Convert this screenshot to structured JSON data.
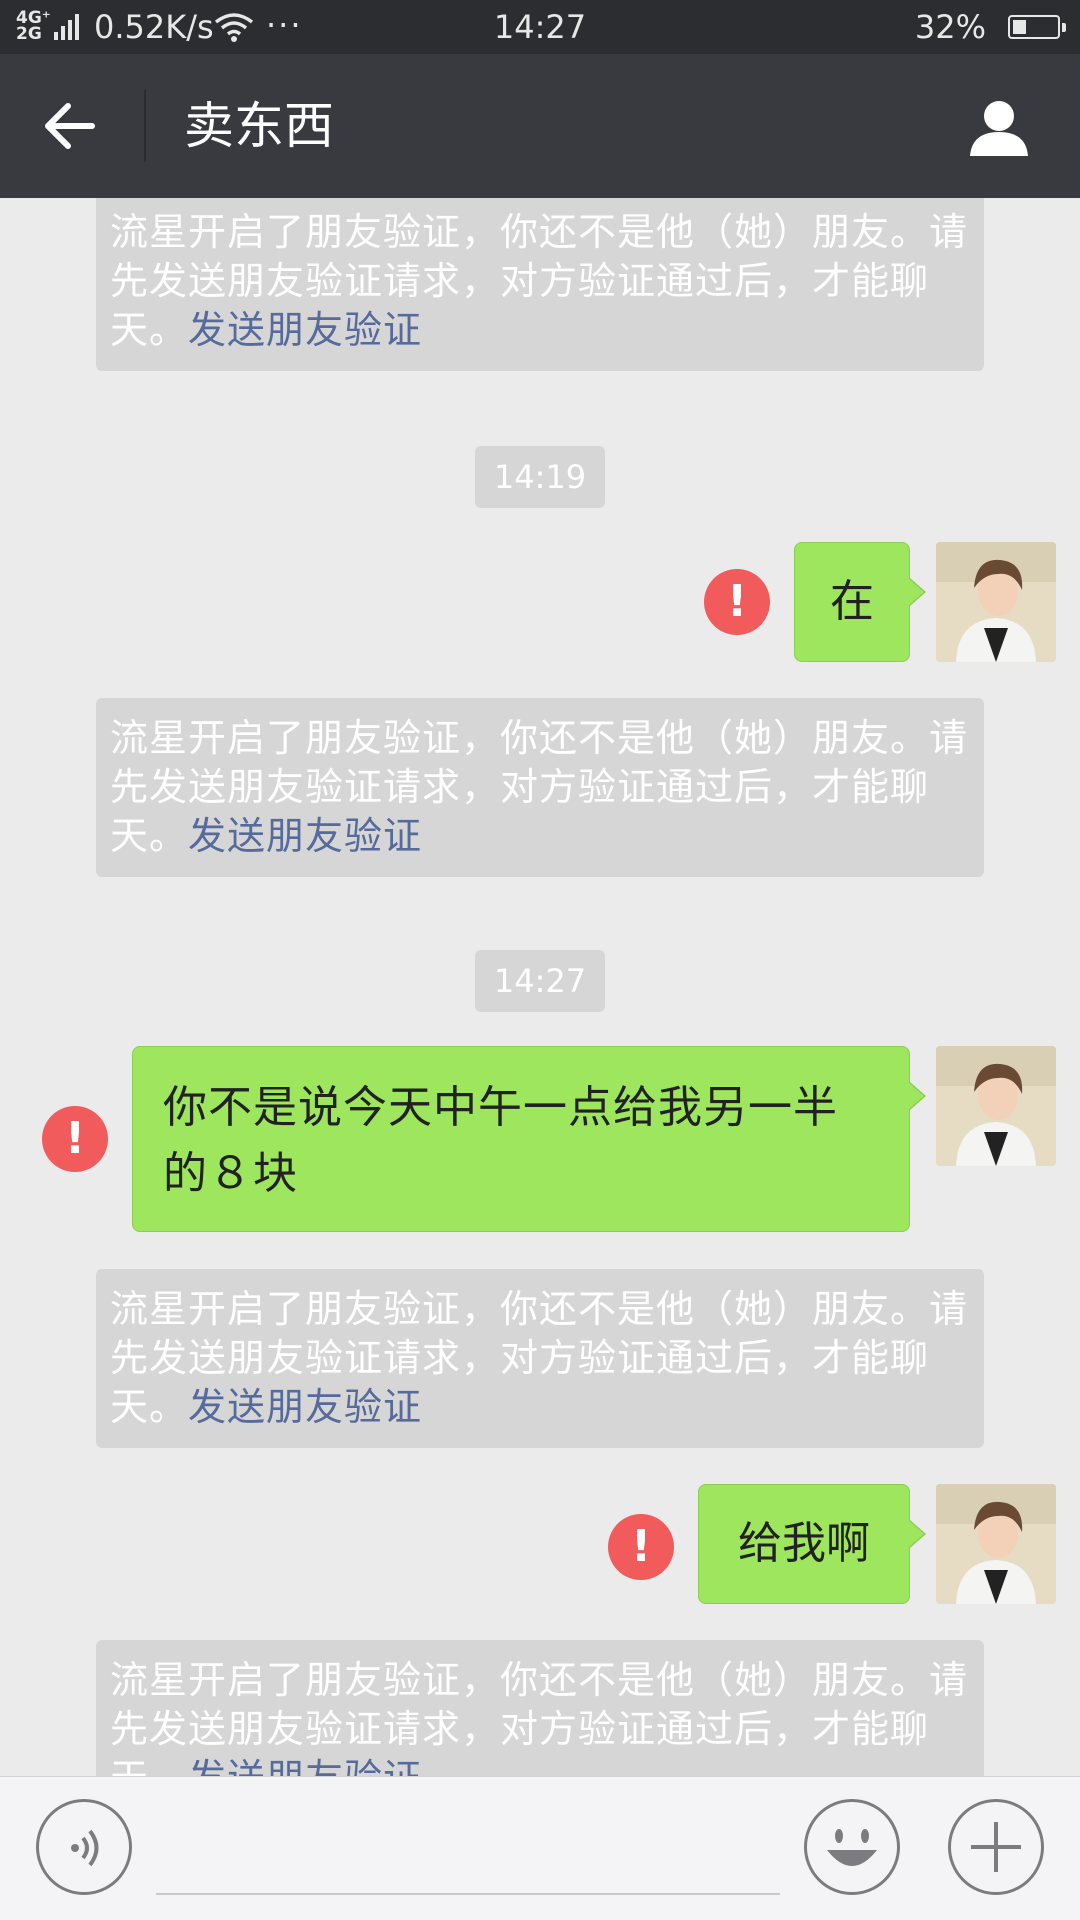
{
  "status_bar": {
    "network_top": "4G⁺",
    "network_bottom": "2G",
    "speed": "0.52K/s",
    "dots": "···",
    "time": "14:27",
    "battery_percent_text": "32%",
    "battery_level": 0.32
  },
  "header": {
    "title": "卖东西",
    "back_icon": "arrow-left-icon",
    "profile_icon": "person-icon"
  },
  "system_notice": {
    "text": "流星开启了朋友验证，你还不是他（她）朋友。请先发送朋友验证请求，对方验证通过后，才能聊天。",
    "link": "发送朋友验证"
  },
  "timestamps": [
    "14:19",
    "14:27"
  ],
  "messages": [
    {
      "text": "在",
      "status": "failed"
    },
    {
      "text": "你不是说今天中午一点给我另一半的８块",
      "status": "failed"
    },
    {
      "text": "给我啊",
      "status": "failed"
    }
  ],
  "error_mark": "!",
  "input_bar": {
    "voice_icon": "voice-icon",
    "emoji_icon": "smiley-icon",
    "more_icon": "plus-icon"
  },
  "colors": {
    "header_bg": "#393a3f",
    "bubble_green": "#9ee65d",
    "error_red": "#f25b5b",
    "link_blue": "#566b9b"
  }
}
